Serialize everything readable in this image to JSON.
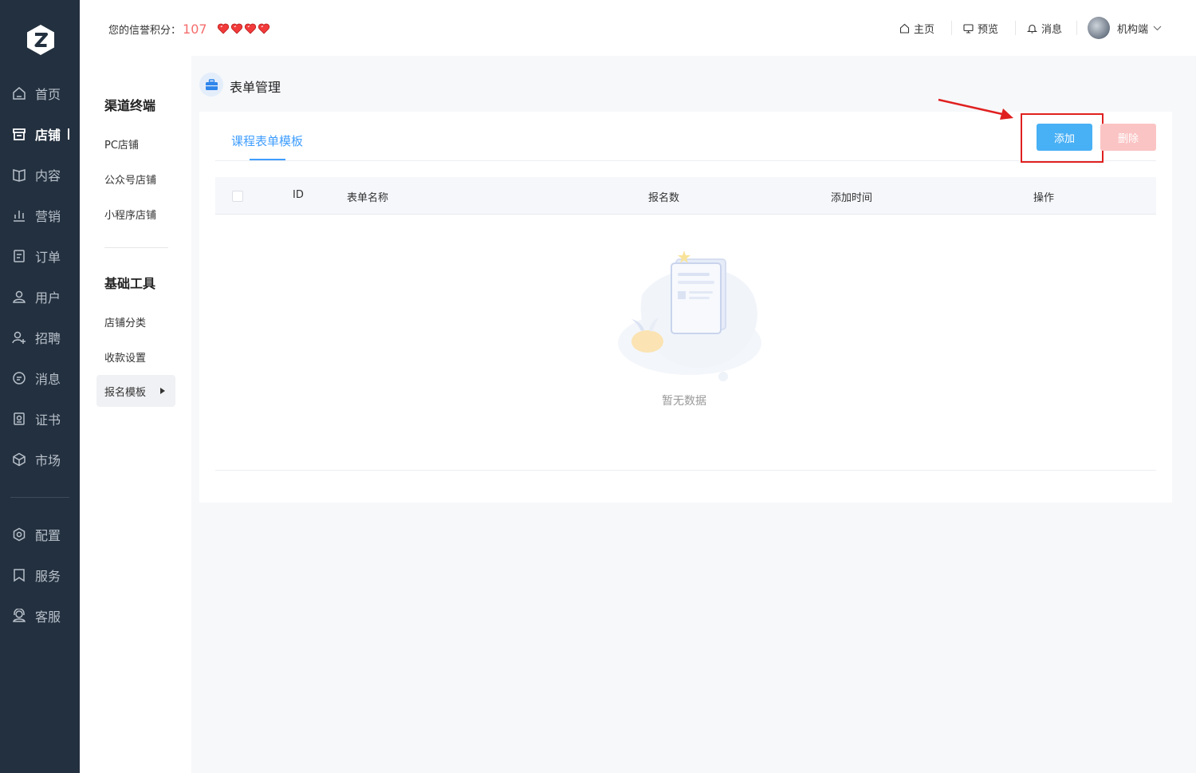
{
  "nav": {
    "items": [
      {
        "label": "首页",
        "icon": "home-icon"
      },
      {
        "label": "店铺",
        "icon": "store-icon",
        "active": true
      },
      {
        "label": "内容",
        "icon": "book-icon"
      },
      {
        "label": "营销",
        "icon": "chart-bar-icon"
      },
      {
        "label": "订单",
        "icon": "document-icon"
      },
      {
        "label": "用户",
        "icon": "user-icon"
      },
      {
        "label": "招聘",
        "icon": "user-add-icon"
      },
      {
        "label": "消息",
        "icon": "message-icon"
      },
      {
        "label": "证书",
        "icon": "certificate-icon"
      },
      {
        "label": "市场",
        "icon": "cube-icon"
      },
      {
        "label": "配置",
        "icon": "gear-icon"
      },
      {
        "label": "服务",
        "icon": "bookmark-icon"
      },
      {
        "label": "客服",
        "icon": "support-icon"
      }
    ]
  },
  "header": {
    "credit_label": "您的信誉积分：",
    "credit_score": "107",
    "hearts": 4,
    "links": {
      "home": "主页",
      "preview": "预览",
      "messages": "消息"
    },
    "user_name": "机构端"
  },
  "submenu": {
    "section1_title": "渠道终端",
    "section1_items": [
      "PC店铺",
      "公众号店铺",
      "小程序店铺"
    ],
    "section2_title": "基础工具",
    "section2_items": [
      "店铺分类",
      "收款设置"
    ],
    "active_item": "报名模板"
  },
  "page": {
    "title": "表单管理",
    "tab": "课程表单模板",
    "add_button": "添加",
    "delete_button": "删除",
    "columns": [
      "ID",
      "表单名称",
      "报名数",
      "添加时间",
      "操作"
    ],
    "empty_text": "暂无数据"
  },
  "colors": {
    "nav_bg": "#23303f",
    "accent": "#409eff",
    "add_button": "#48b0f5",
    "delete_button": "#fbc4c4",
    "credit_score": "#f56c6c",
    "annotation_red": "#e02020"
  }
}
